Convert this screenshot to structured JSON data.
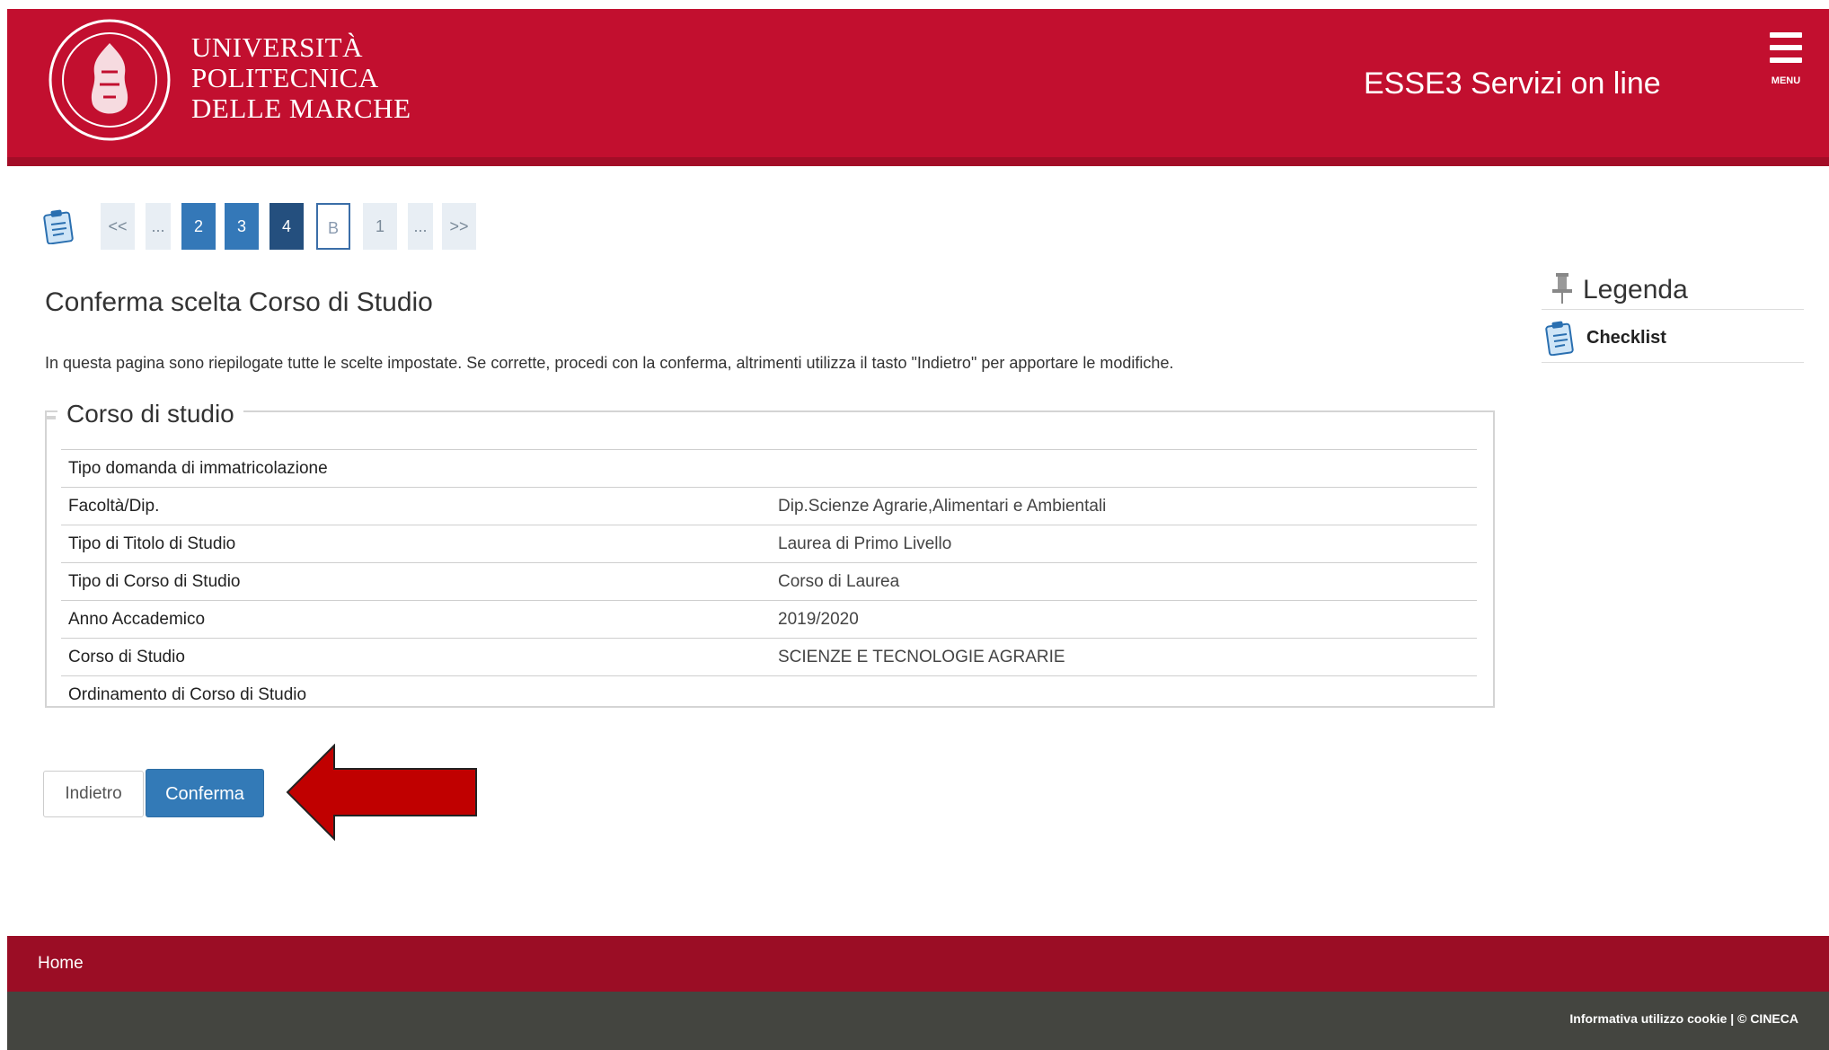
{
  "header": {
    "university_lines": [
      "UNIVERSITÀ",
      "POLITECNICA",
      "DELLE MARCHE"
    ],
    "service_title": "ESSE3 Servizi on line",
    "menu_label": "MENU",
    "seal_icon": "university-seal-icon",
    "colors": {
      "header_red": "#c20f2f",
      "footer_red": "#9b0d25",
      "footer_gray": "#444540",
      "button_blue": "#337ab7"
    }
  },
  "steps": {
    "items": [
      "<<",
      "...",
      "2",
      "3",
      "4",
      "B",
      "1",
      "...",
      ">>"
    ],
    "current": "B"
  },
  "main": {
    "title": "Conferma scelta Corso di Studio",
    "intro": "In questa pagina sono riepilogate tutte le scelte impostate. Se corrette, procedi con la conferma, altrimenti utilizza il tasto \"Indietro\" per apportare le modifiche.",
    "fieldset_legend": "Corso di studio",
    "rows": [
      {
        "key": "Tipo domanda di immatricolazione",
        "value": ""
      },
      {
        "key": "Facoltà/Dip.",
        "value": "Dip.Scienze Agrarie,Alimentari e Ambientali"
      },
      {
        "key": "Tipo di Titolo di Studio",
        "value": "Laurea di Primo Livello"
      },
      {
        "key": "Tipo di Corso di Studio",
        "value": "Corso di Laurea"
      },
      {
        "key": "Anno Accademico",
        "value": "2019/2020"
      },
      {
        "key": "Corso di Studio",
        "value": "SCIENZE E TECNOLOGIE AGRARIE"
      },
      {
        "key": "Ordinamento di Corso di Studio",
        "value": ""
      }
    ],
    "back_label": "Indietro",
    "confirm_label": "Conferma"
  },
  "sidebar": {
    "title": "Legenda",
    "checklist_label": "Checklist"
  },
  "footer": {
    "home_label": "Home",
    "cookie_text": "Informativa utilizzo cookie | © CINECA"
  }
}
